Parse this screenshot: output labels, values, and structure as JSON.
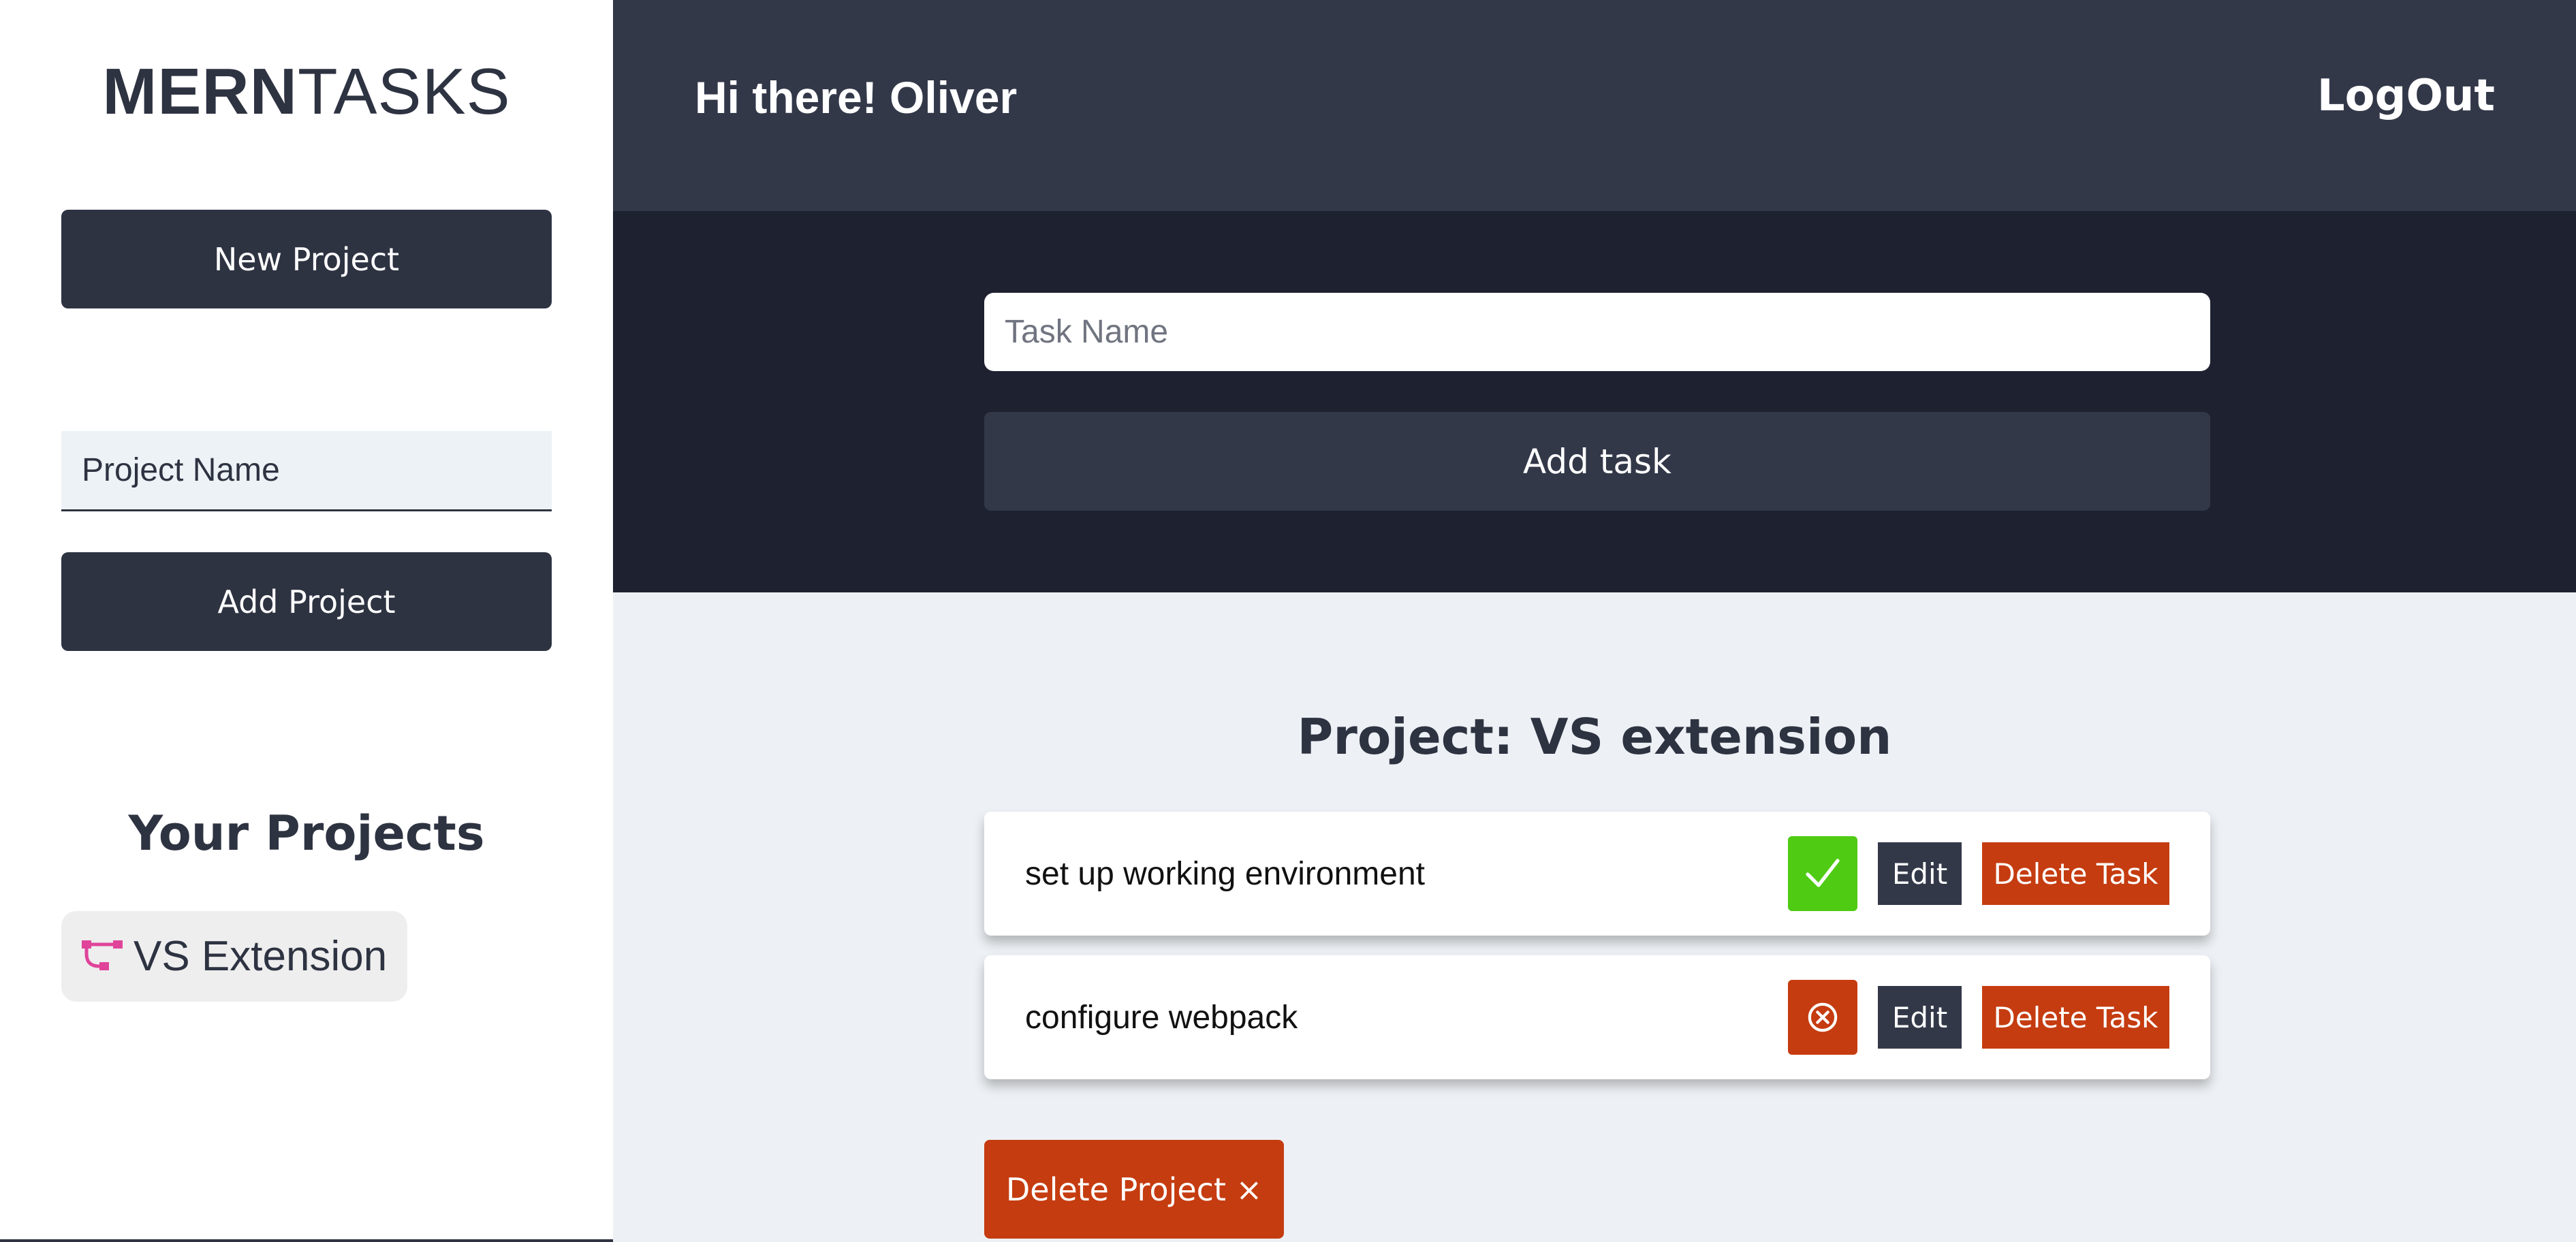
{
  "sidebar": {
    "logo_bold": "MERN",
    "logo_thin": "TASKS",
    "new_project_label": "New Project",
    "project_name_placeholder": "Project Name",
    "add_project_label": "Add Project",
    "projects_title": "Your Projects",
    "projects": [
      {
        "label": "VS Extension",
        "icon": "project-tree-icon"
      }
    ]
  },
  "header": {
    "greeting": "Hi there! Oliver",
    "logout_label": "LogOut"
  },
  "task_form": {
    "task_name_placeholder": "Task Name",
    "add_task_label": "Add task"
  },
  "main": {
    "project_title": "Project: VS extension",
    "tasks": [
      {
        "name": "set up working environment",
        "state": "complete",
        "state_icon": "check-icon",
        "edit_label": "Edit",
        "delete_label": "Delete Task"
      },
      {
        "name": "configure webpack",
        "state": "incomplete",
        "state_icon": "circle-x-icon",
        "edit_label": "Edit",
        "delete_label": "Delete Task"
      }
    ],
    "delete_project_label": "Delete Project ×"
  },
  "colors": {
    "dark": "#2e3342",
    "header": "#333849",
    "form_band": "#1e2130",
    "content_bg": "#edf1f5",
    "danger": "#c53c10",
    "success": "#4fcb13",
    "project_icon": "#e0449a"
  }
}
